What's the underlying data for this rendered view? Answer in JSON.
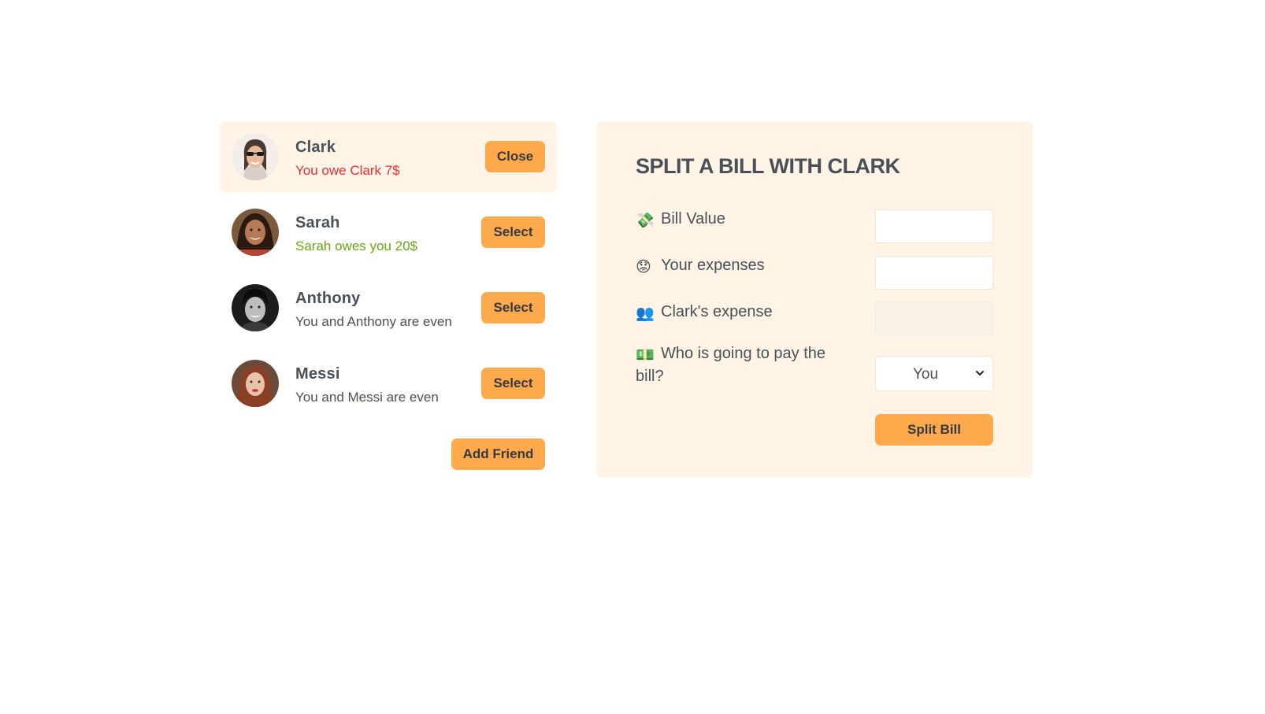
{
  "friends": [
    {
      "name": "Clark",
      "status": "You owe Clark 7$",
      "button": "Close",
      "selected": true
    },
    {
      "name": "Sarah",
      "status": "Sarah owes you 20$",
      "button": "Select",
      "selected": false
    },
    {
      "name": "Anthony",
      "status": "You and Anthony are even",
      "button": "Select",
      "selected": false
    },
    {
      "name": "Messi",
      "status": "You and Messi are even",
      "button": "Select",
      "selected": false
    }
  ],
  "add_friend_label": "Add Friend",
  "form": {
    "title": "SPLIT A BILL WITH CLARK",
    "bill_value": {
      "emoji": "💸",
      "label": "Bill Value",
      "value": ""
    },
    "your_expense": {
      "emoji": "😟",
      "label": "Your expenses",
      "value": ""
    },
    "friend_expense": {
      "emoji": "👥",
      "label": "Clark's expense",
      "value": ""
    },
    "payer": {
      "emoji": "💵",
      "label": "Who is going to pay the bill?",
      "selected": "You"
    },
    "submit_label": "Split Bill"
  },
  "colors": {
    "accent": "#ffa94d",
    "panel": "#fff4e6",
    "text": "#495057",
    "owe": "#e03131",
    "owed": "#66a80f"
  }
}
